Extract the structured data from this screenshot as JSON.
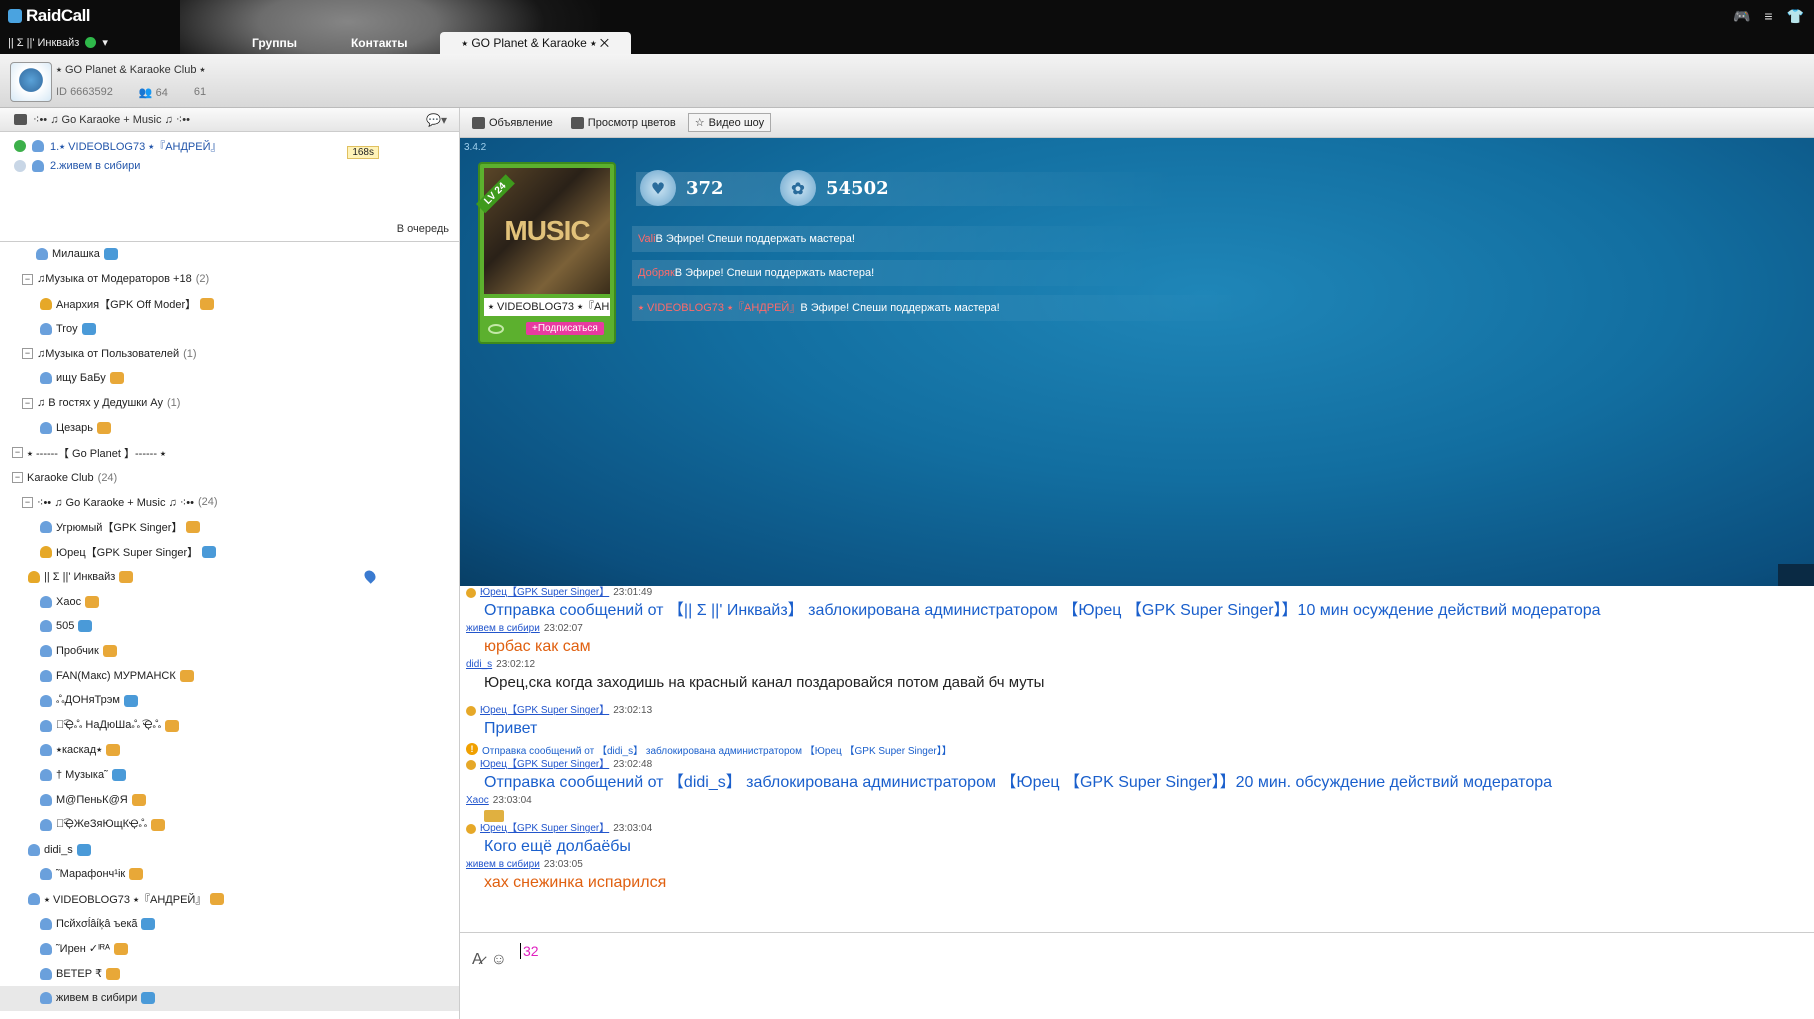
{
  "app": {
    "logo": "RaidCall",
    "user": "|| Σ ||' Инквайз"
  },
  "tabs": [
    "Группы",
    "Контакты",
    "⭑ GO Planet & Karaoke ⭑"
  ],
  "server": {
    "name": "⭑ GO Planet & Karaoke Club ⭑",
    "id_label": "ID",
    "id": "6663592",
    "members": "64",
    "online": "61"
  },
  "left_header": {
    "title": "⁖•• ♫ Go Karaoke + Music ♫ ⁖••"
  },
  "queue": {
    "items": [
      {
        "label": "1.⭑ VIDEOBLOG73 ⭑『АНДРЕЙ』",
        "speaking": true
      },
      {
        "label": "2.живем в сибири",
        "speaking": false
      }
    ],
    "timer": "168s",
    "join_button": "В очередь"
  },
  "tree": [
    {
      "t": "Милашка",
      "k": "user",
      "i": 36
    },
    {
      "t": "♫Музыка от Модераторов +18",
      "k": "chan",
      "c": "(2)",
      "i": 22
    },
    {
      "t": "Анархия【GPK Off Moder】",
      "k": "user",
      "gold": true,
      "i": 40
    },
    {
      "t": "Troy",
      "k": "user",
      "i": 40
    },
    {
      "t": "♫Музыка от Пользователей",
      "k": "chan",
      "c": "(1)",
      "i": 22
    },
    {
      "t": "ищу БаБу",
      "k": "user",
      "i": 40
    },
    {
      "t": "♫ В гостях у Дедушки Ау",
      "k": "chan",
      "c": "(1)",
      "i": 22
    },
    {
      "t": "Цезарь",
      "k": "user",
      "i": 40
    },
    {
      "t": "⭑ ------【 Go Planet 】------ ⭑",
      "k": "chan",
      "i": 12
    },
    {
      "t": "Karaoke Club",
      "k": "chan",
      "c": "(24)",
      "i": 12
    },
    {
      "t": "⁖•• ♫ Go Karaoke + Music ♫ ⁖••",
      "k": "chan",
      "c": "(24)",
      "red": true,
      "i": 22
    },
    {
      "t": "Угрюмый【GPK Singer】",
      "k": "user",
      "i": 40
    },
    {
      "t": "Юрец【GPK Super Singer】",
      "k": "user",
      "gold": true,
      "i": 40
    },
    {
      "t": "|| Σ ||' Инквайз",
      "k": "user",
      "gold": true,
      "i": 28,
      "pin": true
    },
    {
      "t": "Хаос",
      "k": "user",
      "i": 40
    },
    {
      "t": "505",
      "k": "user",
      "i": 40
    },
    {
      "t": "Пробчик",
      "k": "user",
      "i": 40
    },
    {
      "t": "FAN(Макс) МУРМАНСК",
      "k": "user",
      "i": 40
    },
    {
      "t": "ஃДОНяТрэм",
      "k": "user",
      "i": 40
    },
    {
      "t": "ஃ͡Ҿஃ НаДюШаஃ ͡Ҿஃ",
      "k": "user",
      "i": 40
    },
    {
      "t": "⭑каскад⭑",
      "k": "user",
      "i": 40
    },
    {
      "t": "† Музыка˜",
      "k": "user",
      "i": 40
    },
    {
      "t": "М@ПеньК@Я",
      "k": "user",
      "i": 40
    },
    {
      "t": "ஃ͡ҾЖеЗяЮщКҾஃ",
      "k": "user",
      "i": 40
    },
    {
      "t": "didi_s",
      "k": "user",
      "i": 28
    },
    {
      "t": "˜Марафонч¹ік",
      "k": "user",
      "i": 40
    },
    {
      "t": "⭑ VIDEOBLOG73 ⭑『АНДРЕЙ』",
      "k": "user",
      "i": 28
    },
    {
      "t": "Псйхσĺâίķâ ъекã",
      "k": "user",
      "i": 40
    },
    {
      "t": "˜Ирен ✓ᴵᴿᴬ",
      "k": "user",
      "i": 40
    },
    {
      "t": "ВЕТЕР ₹",
      "k": "user",
      "i": 40
    },
    {
      "t": "живем в сибири",
      "k": "user",
      "i": 40,
      "sel": true
    }
  ],
  "toolbar": {
    "announce": "Объявление",
    "colors": "Просмотр цветов",
    "video": "Видео шоу"
  },
  "stage": {
    "version": "3.4.2",
    "card": {
      "level": "LV 24",
      "image_text": "MUSIC",
      "name": "⭑ VIDEOBLOG73 ⭑『АН",
      "subscribe": "+Подписаться"
    },
    "stats": [
      {
        "icon": "heart-icon",
        "value": "372"
      },
      {
        "icon": "rose-icon",
        "value": "54502"
      }
    ],
    "announcements": [
      {
        "who": "Vali",
        "text": "В Эфире! Спеши поддержать мастера!"
      },
      {
        "who": "Добряк",
        "text": "В Эфире! Спеши поддержать мастера!"
      },
      {
        "who": "⭑ VIDEOBLOG73 ⭑『АНДРЕЙ』",
        "text": "В Эфире! Спеши поддержать мастера!"
      }
    ]
  },
  "chat": [
    {
      "nick": "Юрец【GPK Super Singer】",
      "time": "23:01:49",
      "crown": true,
      "body": "Отправка сообщений от 【|| Σ ||' Инквайз】 заблокирована администратором 【Юрец 【GPK Super Singer】】10 мин осуждение действий модератора",
      "style": "blue"
    },
    {
      "nick": "живем в сибири",
      "time": "23:02:07",
      "body": "юрбас как сам",
      "style": "orange"
    },
    {
      "nick": "didi_s",
      "time": "23:02:12",
      "body": "Юрец,ска когда заходишь на красный канал поздаровайся потом давай бч муты",
      "style": "dark"
    },
    {
      "nick": "Юрец【GPK Super Singer】",
      "time": "23:02:13",
      "crown": true,
      "body": "Привет",
      "style": "blue"
    },
    {
      "system": "Отправка сообщений от 【didi_s】 заблокирована администратором 【Юрец 【GPK Super Singer】】"
    },
    {
      "nick": "Юрец【GPK Super Singer】",
      "time": "23:02:48",
      "crown": true,
      "body": "Отправка сообщений от 【didi_s】 заблокирована администратором 【Юрец 【GPK Super Singer】】20 мин. обсуждение действий модератора",
      "style": "blue"
    },
    {
      "nick": "Хаос",
      "time": "23:03:04",
      "gift": true
    },
    {
      "nick": "Юрец【GPK Super Singer】",
      "time": "23:03:04",
      "crown": true,
      "body": "Кого ещё долбаёбы",
      "style": "blue"
    },
    {
      "nick": "живем в сибири",
      "time": "23:03:05",
      "body": "хах снежинка испарился",
      "style": "orange"
    }
  ],
  "input": {
    "text": "32"
  }
}
